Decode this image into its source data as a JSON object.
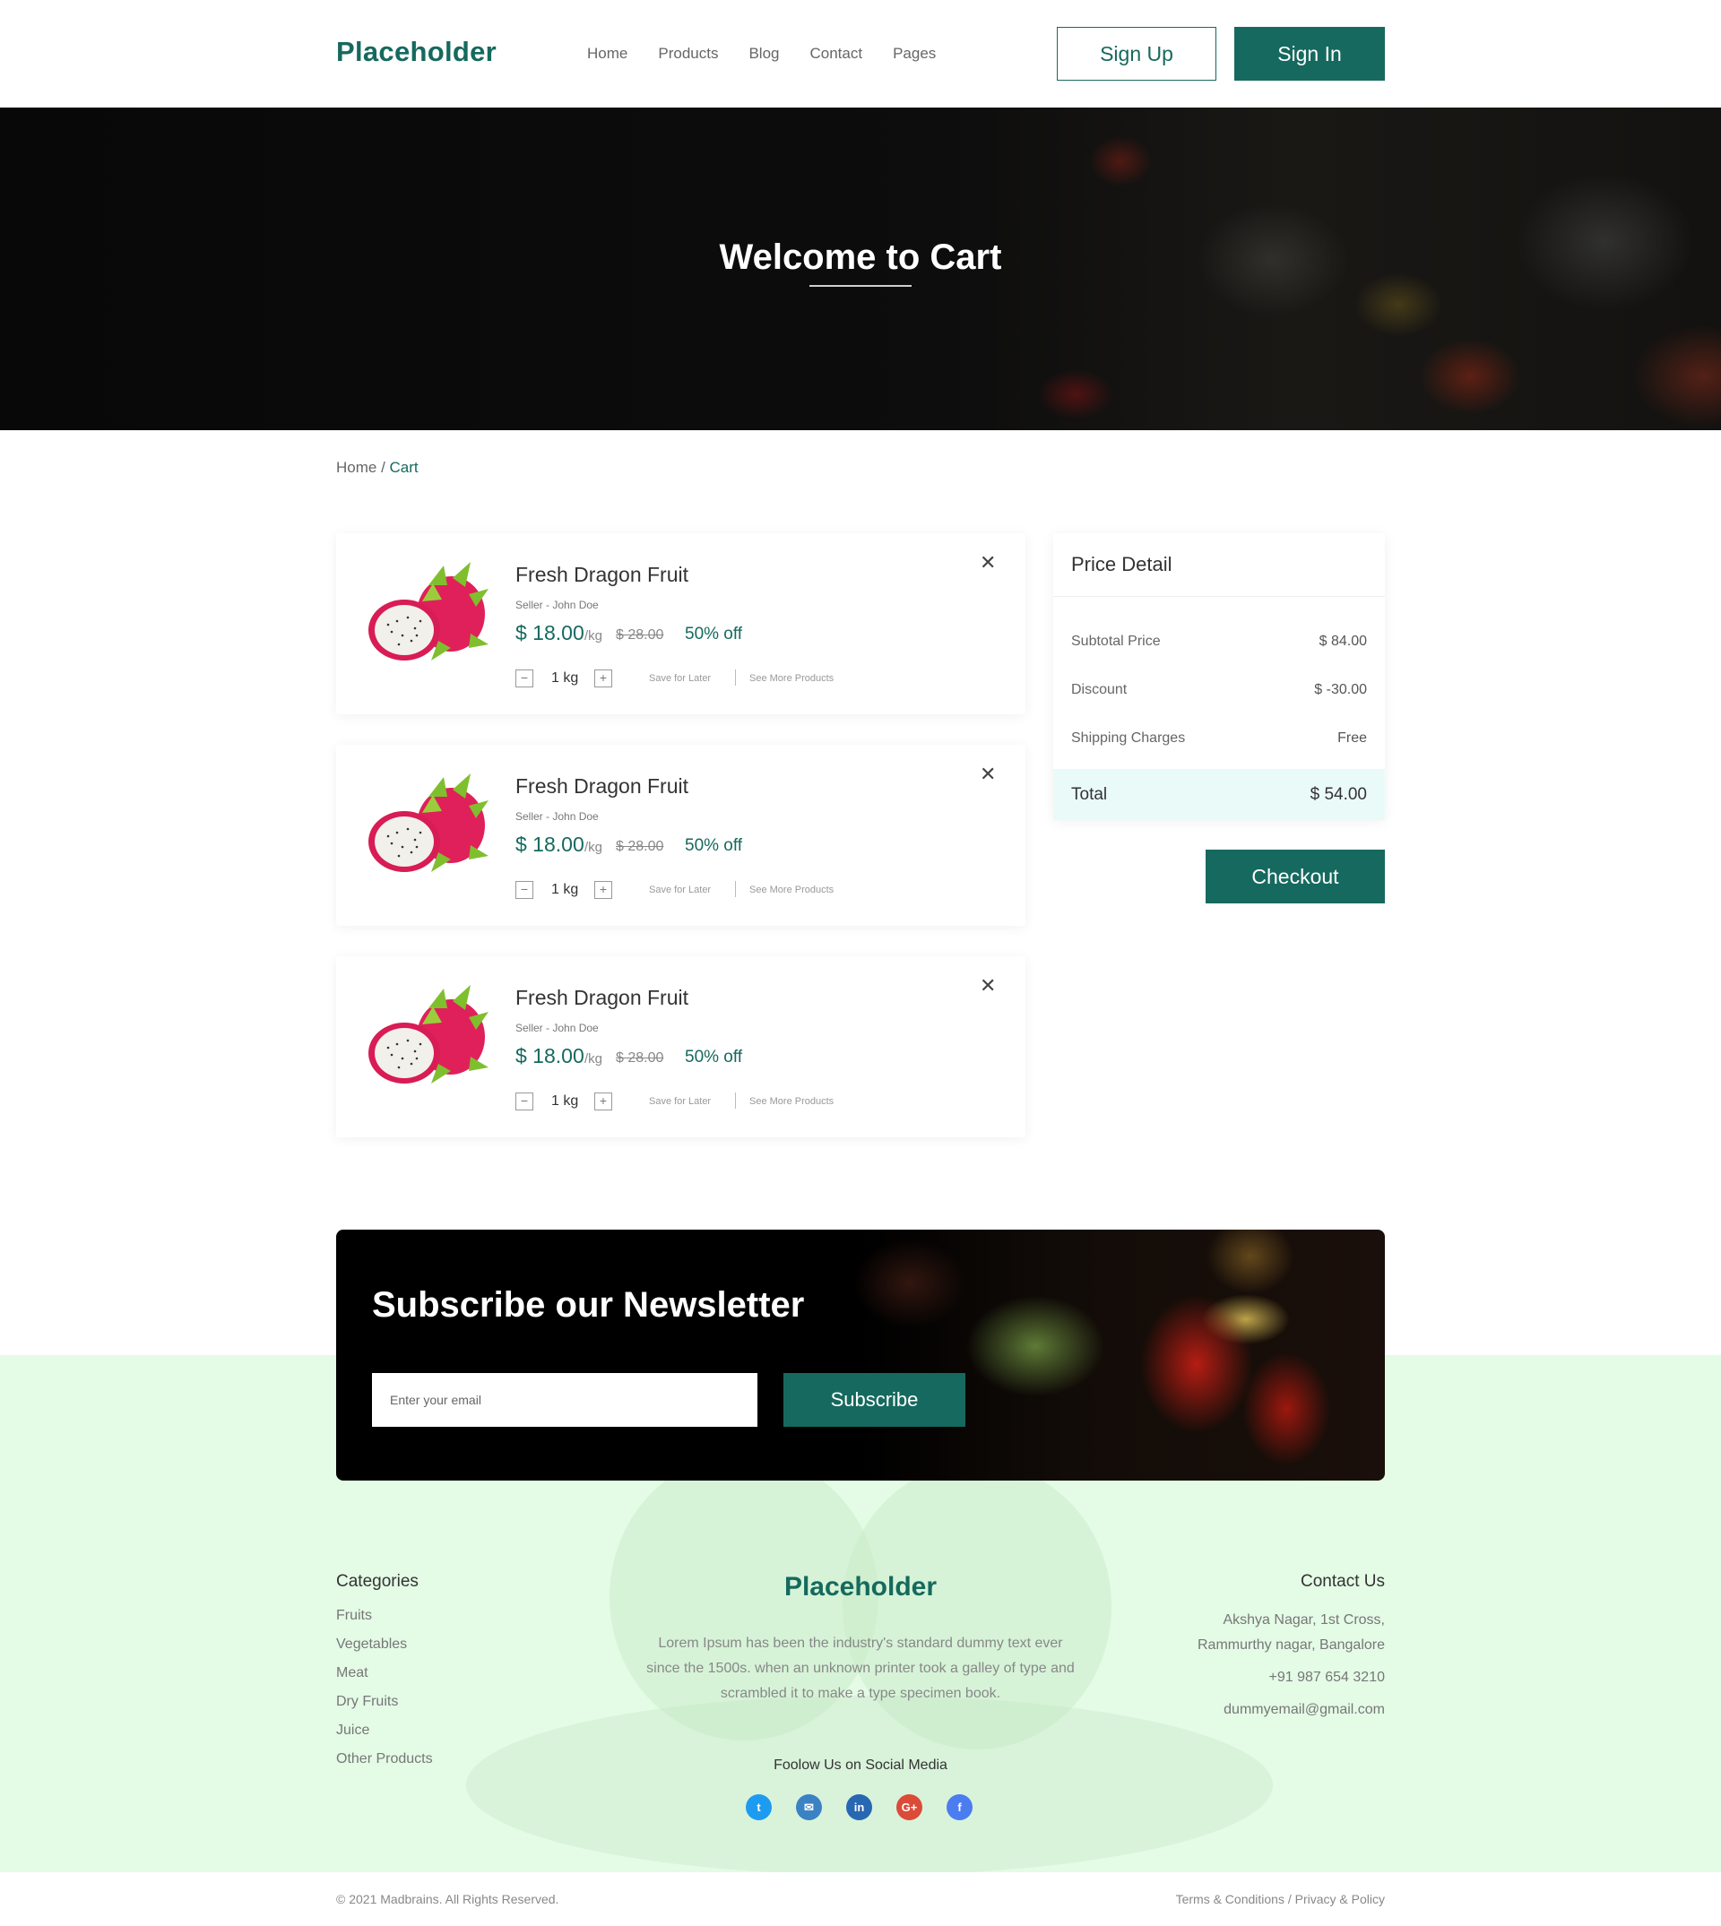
{
  "header": {
    "logo": "Placeholder",
    "nav": [
      "Home",
      "Products",
      "Blog",
      "Contact",
      "Pages"
    ],
    "sign_up": "Sign Up",
    "sign_in": "Sign In"
  },
  "hero": {
    "title": "Welcome to Cart"
  },
  "breadcrumb": {
    "home": "Home",
    "separator": " / ",
    "current": "Cart"
  },
  "cart_items": [
    {
      "name": "Fresh Dragon Fruit",
      "seller": "Seller - John Doe",
      "price": "$ 18.00",
      "unit": "/kg",
      "old_price": "$ 28.00",
      "discount": "50% off",
      "qty": "1 kg",
      "save_later": "Save for Later",
      "see_more": "See More Products"
    },
    {
      "name": "Fresh Dragon Fruit",
      "seller": "Seller - John Doe",
      "price": "$ 18.00",
      "unit": "/kg",
      "old_price": "$ 28.00",
      "discount": "50% off",
      "qty": "1 kg",
      "save_later": "Save for Later",
      "see_more": "See More Products"
    },
    {
      "name": "Fresh Dragon Fruit",
      "seller": "Seller - John Doe",
      "price": "$ 18.00",
      "unit": "/kg",
      "old_price": "$ 28.00",
      "discount": "50% off",
      "qty": "1 kg",
      "save_later": "Save for Later",
      "see_more": "See More Products"
    }
  ],
  "price_detail": {
    "title": "Price Detail",
    "rows": [
      {
        "label": "Subtotal Price",
        "value": "$ 84.00"
      },
      {
        "label": "Discount",
        "value": "$ -30.00"
      },
      {
        "label": "Shipping Charges",
        "value": "Free"
      }
    ],
    "total_label": "Total",
    "total_value": "$ 54.00",
    "checkout": "Checkout"
  },
  "newsletter": {
    "title": "Subscribe our Newsletter",
    "placeholder": "Enter your email",
    "button": "Subscribe"
  },
  "footer": {
    "categories_title": "Categories",
    "categories": [
      "Fruits",
      "Vegetables",
      "Meat",
      "Dry Fruits",
      "Juice",
      "Other Products"
    ],
    "logo": "Placeholder",
    "description": "Lorem Ipsum has been the industry's standard dummy text ever since the 1500s. when an unknown printer took a galley of type and scrambled it to make a type specimen book.",
    "follow": "Foolow Us on Social Media",
    "socials": [
      {
        "icon": "twitter-icon",
        "glyph": "t",
        "color": "#1d9bf0"
      },
      {
        "icon": "mail-icon",
        "glyph": "✉",
        "color": "#3b82c4"
      },
      {
        "icon": "linkedin-icon",
        "glyph": "in",
        "color": "#2867b2"
      },
      {
        "icon": "google-plus-icon",
        "glyph": "G+",
        "color": "#dc4a38"
      },
      {
        "icon": "facebook-icon",
        "glyph": "f",
        "color": "#4b7cf0"
      }
    ],
    "contact_title": "Contact Us",
    "address_1": "Akshya Nagar, 1st Cross,",
    "address_2": "Rammurthy nagar, Bangalore",
    "phone": "+91 987 654 3210",
    "email": "dummyemail@gmail.com",
    "copyright": "© 2021 Madbrains. All Rights Reserved.",
    "terms": "Terms & Conditions",
    "terms_sep": " / ",
    "privacy": "Privacy & Policy"
  },
  "colors": {
    "brand": "#16695e",
    "footer_bg": "#e4fbe6",
    "total_bg": "#eafaf8"
  }
}
